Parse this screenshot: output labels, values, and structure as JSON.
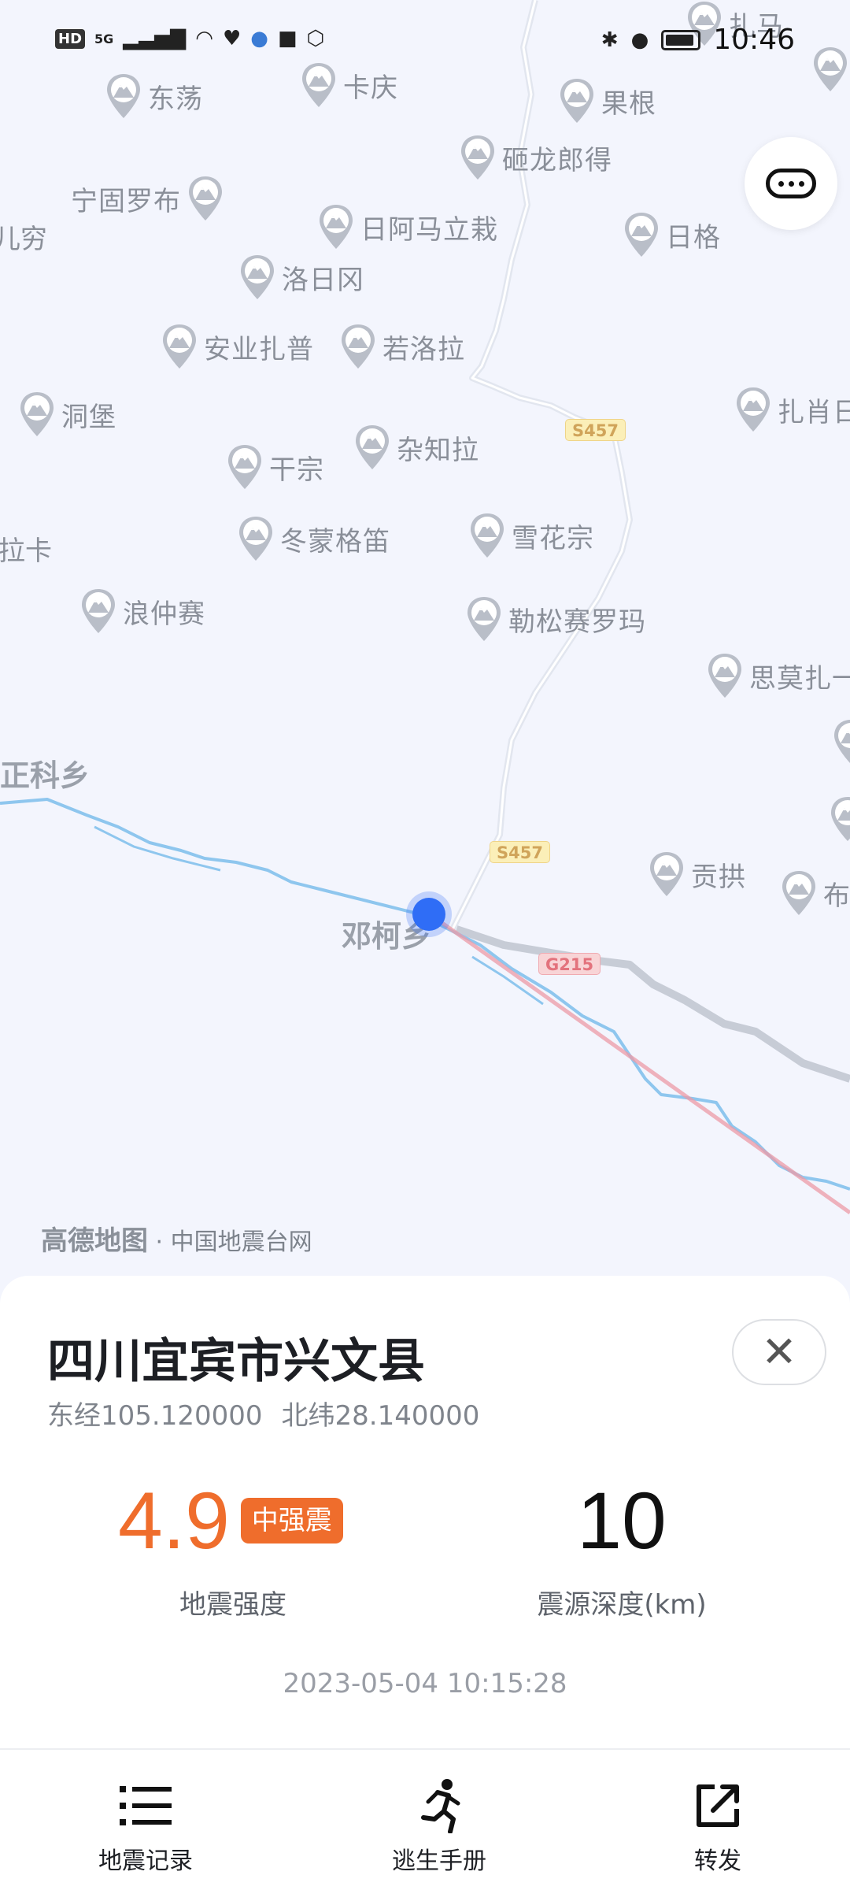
{
  "status_bar": {
    "time": "10:46",
    "network": "5G",
    "hd": "HD"
  },
  "map": {
    "pois": [
      {
        "name": "扎马"
      },
      {
        "name": "东荡"
      },
      {
        "name": "卡庆"
      },
      {
        "name": "果根"
      },
      {
        "name": "砸龙郎得"
      },
      {
        "name": "宁固罗布"
      },
      {
        "name": "日阿马立栽"
      },
      {
        "name": "日格"
      },
      {
        "name": "洛日冈"
      },
      {
        "name": "安业扎普"
      },
      {
        "name": "若洛拉"
      },
      {
        "name": "洞堡"
      },
      {
        "name": "扎肖日"
      },
      {
        "name": "杂知拉"
      },
      {
        "name": "干宗"
      },
      {
        "name": "冬蒙格笛"
      },
      {
        "name": "雪花宗"
      },
      {
        "name": "浪仲赛"
      },
      {
        "name": "勒松赛罗玛"
      },
      {
        "name": "思莫扎一"
      },
      {
        "name": "贡拱"
      },
      {
        "name": "布"
      }
    ],
    "edge_labels": {
      "left1": "儿穷",
      "left2": "拉卡"
    },
    "towns": {
      "zhengke": "正科乡",
      "dengke": "邓柯乡"
    },
    "road_shields": {
      "s457_a": "S457",
      "s457_b": "S457",
      "g215": "G215"
    },
    "attribution": {
      "brand": "高德地图",
      "rest": " · 中国地震台网"
    },
    "more_icon": "more-dots-icon"
  },
  "quake": {
    "location": "四川宜宾市兴文县",
    "longitude_text": "东经105.120000",
    "latitude_text": "北纬28.140000",
    "magnitude": "4.9",
    "magnitude_level": "中强震",
    "magnitude_label": "地震强度",
    "depth": "10",
    "depth_label": "震源深度(km)",
    "time": "2023-05-04 10:15:28"
  },
  "nav": [
    {
      "label": "地震记录",
      "icon": "list-icon"
    },
    {
      "label": "逃生手册",
      "icon": "running-person-icon"
    },
    {
      "label": "转发",
      "icon": "share-icon"
    }
  ],
  "colors": {
    "accent": "#ef6d2c",
    "epicenter": "#2f6df6"
  }
}
